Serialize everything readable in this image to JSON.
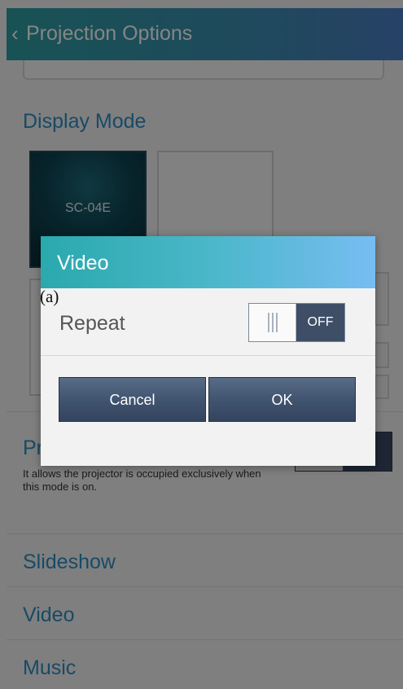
{
  "header": {
    "back_glyph": "‹",
    "title": "Projection Options"
  },
  "display_mode": {
    "title": "Display Mode",
    "tile_label": "SC-04E"
  },
  "exclusive_mode": {
    "label_visible": "Pr",
    "description": "It allows the projector is occupied exclusively when this mode is on.",
    "toggle_state": "F"
  },
  "list": {
    "slideshow": "Slideshow",
    "video": "Video",
    "music": "Music"
  },
  "dialog": {
    "title": "Video",
    "overlay_label": "(a)",
    "repeat_label": "Repeat",
    "repeat_toggle": {
      "state": "OFF"
    },
    "cancel_label": "Cancel",
    "ok_label": "OK"
  },
  "colors": {
    "accent": "#2f8fc3",
    "button": "#435672",
    "header_start": "#2f9ea3",
    "header_end": "#4a7ec4"
  }
}
